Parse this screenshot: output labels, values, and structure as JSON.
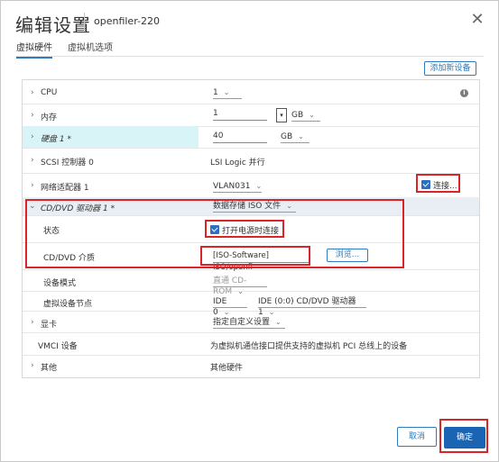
{
  "header": {
    "title": "编辑设置",
    "vm_name": "openfiler-220"
  },
  "tabs": [
    "虚拟硬件",
    "虚拟机选项"
  ],
  "toolbar": {
    "add_device": "添加新设备"
  },
  "rows": {
    "cpu": {
      "label": "CPU",
      "value": "1"
    },
    "memory": {
      "label": "内存",
      "value": "1",
      "unit": "GB"
    },
    "disk": {
      "label": "硬盘 1 *",
      "value": "40",
      "unit": "GB"
    },
    "scsi": {
      "label": "SCSI 控制器 0",
      "value": "LSI Logic 并行"
    },
    "network": {
      "label": "网络适配器 1",
      "value": "VLAN031",
      "connect_label": "连接..."
    },
    "cddvd": {
      "label": "CD/DVD 驱动器 1 *",
      "value": "数据存储 ISO 文件"
    },
    "status": {
      "label": "状态",
      "checkbox_label": "打开电源时连接"
    },
    "media": {
      "label": "CD/DVD 介质",
      "value": "[ISO-Software] ISO/openfi",
      "browse": "浏览..."
    },
    "device_mode": {
      "label": "设备模式",
      "value": "直通 CD-ROM"
    },
    "virtual_node": {
      "label": "虚拟设备节点",
      "ide": "IDE 0",
      "node": "IDE (0:0) CD/DVD 驱动器 1"
    },
    "video": {
      "label": "显卡",
      "value": "指定自定义设置"
    },
    "vmci": {
      "label": "VMCI 设备",
      "value": "为虚拟机通信接口提供支持的虚拟机 PCI 总线上的设备"
    },
    "other": {
      "label": "其他",
      "value": "其他硬件"
    }
  },
  "footer": {
    "cancel": "取消",
    "ok": "确定"
  },
  "colors": {
    "accent": "#2f7bbf",
    "highlight": "#d9f4f7",
    "cddvd_bg": "#e9eef5",
    "annotation": "#d9252a"
  }
}
